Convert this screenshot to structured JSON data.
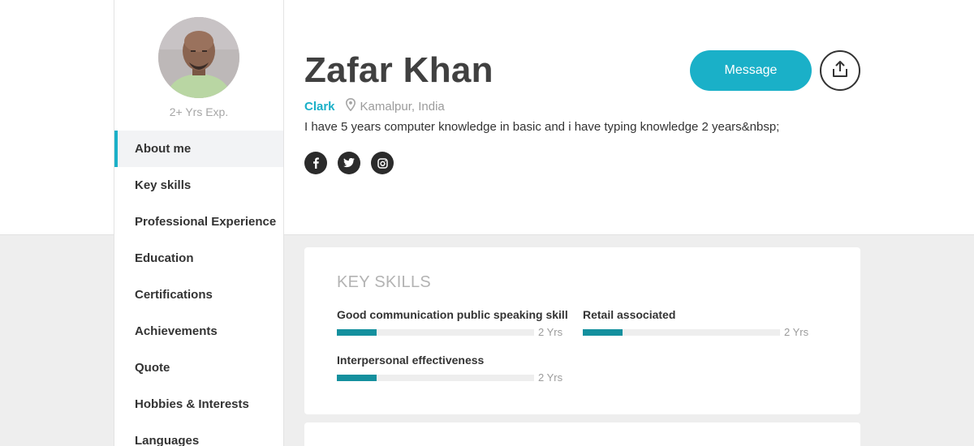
{
  "profile": {
    "name": "Zafar Khan",
    "role": "Clark",
    "location": "Kamalpur, India",
    "bio": "I have 5 years computer knowledge in basic and i have typing knowledge 2 years&nbsp;",
    "experience": "2+ Yrs Exp."
  },
  "actions": {
    "message_label": "Message",
    "share_icon": "share-upload-icon"
  },
  "socials": [
    {
      "icon": "facebook-icon"
    },
    {
      "icon": "twitter-icon"
    },
    {
      "icon": "instagram-icon"
    }
  ],
  "sidebar": {
    "items": [
      {
        "label": "About me",
        "active": true
      },
      {
        "label": "Key skills"
      },
      {
        "label": "Professional Experience"
      },
      {
        "label": "Education"
      },
      {
        "label": "Certifications"
      },
      {
        "label": "Achievements"
      },
      {
        "label": "Quote"
      },
      {
        "label": "Hobbies & Interests"
      },
      {
        "label": "Languages"
      }
    ]
  },
  "key_skills": {
    "title": "KEY SKILLS",
    "items": [
      {
        "name": "Good communication public speaking skill",
        "years": "2 Yrs",
        "level": 0.2
      },
      {
        "name": "Retail associated",
        "years": "2 Yrs",
        "level": 0.2
      },
      {
        "name": "Interpersonal effectiveness",
        "years": "2 Yrs",
        "level": 0.2
      }
    ]
  },
  "colors": {
    "accent": "#1ab0c8",
    "skill_bar": "#14909e",
    "text_dark": "#333333",
    "background": "#eeeeee"
  }
}
